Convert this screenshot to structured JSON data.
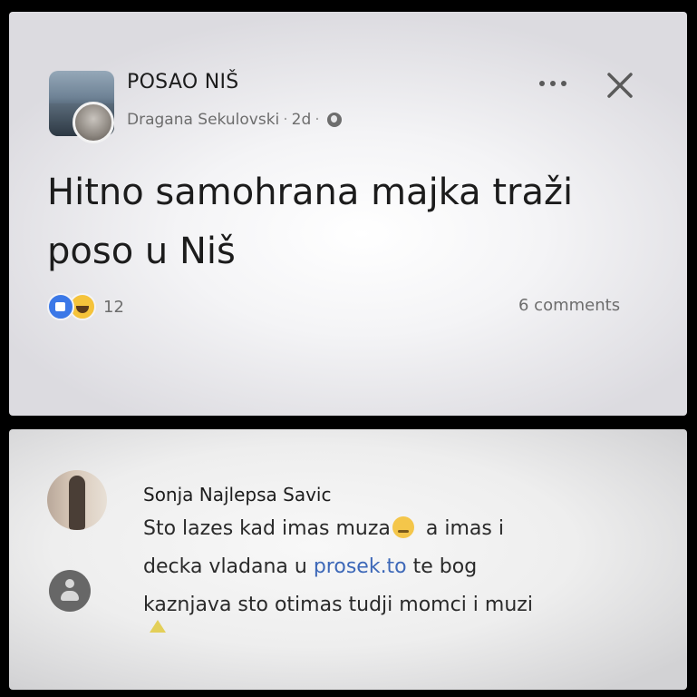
{
  "post": {
    "group_name": "POSAO NIŠ",
    "author": "Dragana Sekulovski",
    "time": "2d",
    "separator": "·",
    "text_line1": "Hitno samohrana majka traži",
    "text_line2": "poso u Niš",
    "reaction_count": "12",
    "comments_label": "6 comments",
    "icons": {
      "more": "more-dots-icon",
      "close": "close-icon",
      "privacy": "globe-icon",
      "reactions": [
        "like-icon",
        "haha-icon"
      ]
    }
  },
  "comment": {
    "author": "Sonja Najlepsa Savic",
    "line1_before_emoji": "Sto lazes kad imas muza",
    "line1_after_emoji": "a imas i",
    "line2_before_link": "decka vladana u ",
    "link": "prosek.to",
    "line2_after_link": " te bog",
    "line3": "kaznjava sto otimas tudji momci i muzi",
    "icons": {
      "emoji": "rolling-eyes-emoji-icon",
      "reply_avatar": "person-icon",
      "trailing": "warning-icon"
    }
  },
  "colors": {
    "background": "#000000",
    "link": "#3d68b8",
    "like_blue": "#3b78e7",
    "haha_yellow": "#f5c33b",
    "meta_gray": "#6d6d6d"
  }
}
